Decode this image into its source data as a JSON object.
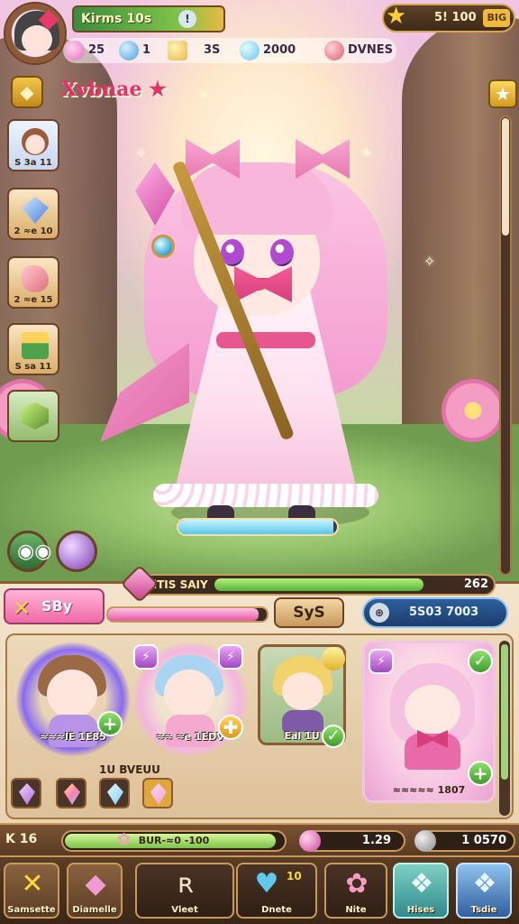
{
  "player": {
    "name": "Kirms 10s",
    "info_icon": "info-icon"
  },
  "currency": {
    "gold": "5! 100",
    "gold_tag": "BIG"
  },
  "resources": [
    {
      "name": "pink-gem",
      "value": "25",
      "color": "#e46fc0"
    },
    {
      "name": "blue-gem",
      "value": "1",
      "color": "#4d9fd9"
    },
    {
      "name": "gold-coin",
      "value": "3S",
      "color": "#e9b944"
    },
    {
      "name": "diamond",
      "value": "2000",
      "color": "#62c7ec"
    },
    {
      "name": "ruby",
      "value": "DVNES",
      "color": "#e05a6a"
    }
  ],
  "title": {
    "text": "Xvbnae ★"
  },
  "left_rail": [
    {
      "name": "hero-portrait",
      "label": "S 3a 11"
    },
    {
      "name": "blue-crystal",
      "label": "2 ≈e 10"
    },
    {
      "name": "pink-meat",
      "label": "2 ≈e 15"
    },
    {
      "name": "green-chest",
      "label": "S sa 11"
    },
    {
      "name": "green-cube",
      "label": ""
    }
  ],
  "xp": {
    "label": "lTIS SAIY",
    "value": "262",
    "fill": 0.86
  },
  "tabs": {
    "pink_tab": "SBy",
    "pink_fill": 0.95,
    "sys_button": "SyS",
    "blue_value": "5S03 7003"
  },
  "heroes": [
    {
      "name": "hero-brown-cat",
      "label": "≈≈≈IE 1E85",
      "hair": "#9b6a44",
      "body": "#b993e8",
      "glow": "#8a6bf0"
    },
    {
      "name": "hero-blue-hair",
      "label": "≈≈ ≈e 1EDV",
      "hair": "#a9d5f2",
      "body": "#f4a9cf",
      "glow": "#f3b6df"
    },
    {
      "name": "hero-blonde",
      "label": "Eal 1U",
      "hair": "#f2d36b",
      "body": "#7e5aa8",
      "glow": "#c9d9b5"
    },
    {
      "name": "hero-pink-cat",
      "label": "≈≈≈≈≈ 1807",
      "hair": "#f6c1e0",
      "body": "#e86aa8",
      "glow": "#ffe6f3"
    }
  ],
  "gems_caption": "1U BVEUU",
  "gems": [
    {
      "name": "purple-gem",
      "color": "#b06ae0"
    },
    {
      "name": "rainbow-gem",
      "color": "#ff7fb0"
    },
    {
      "name": "sky-gem",
      "color": "#7fd0ff"
    },
    {
      "name": "pink-gem",
      "color": "#f29ad6"
    }
  ],
  "status": {
    "level": "K 16",
    "bar_text": "BUR-≈0 -100",
    "bar_fill": 0.96,
    "pink_value": "1.29",
    "grey_value": "1 0570"
  },
  "nav": [
    {
      "name": "samsette",
      "label": "Samsette",
      "icon": "✕"
    },
    {
      "name": "diamelle",
      "label": "Diamelle",
      "icon": "◆"
    },
    {
      "name": "vleet",
      "label": "Vleet",
      "icon": "ʀ"
    },
    {
      "name": "dnete",
      "label": "Dnete",
      "icon": "♥",
      "badge": "10"
    },
    {
      "name": "nite",
      "label": "Nite",
      "icon": "✿"
    },
    {
      "name": "hlses",
      "label": "Hises",
      "icon": "❖"
    },
    {
      "name": "tsdie",
      "label": "Tsdie",
      "icon": "❖"
    }
  ],
  "char_hp": 0.98
}
